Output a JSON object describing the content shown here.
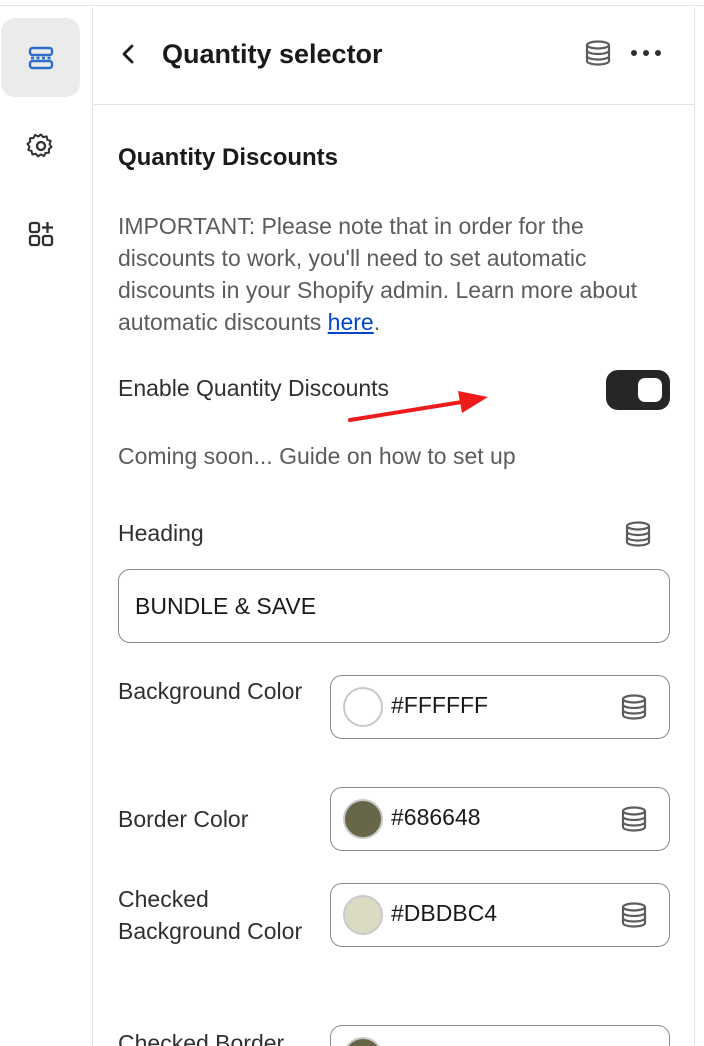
{
  "header": {
    "title": "Quantity selector"
  },
  "section": {
    "title": "Quantity Discounts",
    "note_text": "IMPORTANT: Please note that in order for the discounts to work, you'll need to set automatic discounts in your Shopify admin. Learn more about automatic discounts ",
    "note_link": "here",
    "note_end": "."
  },
  "toggle": {
    "label": "Enable Quantity Discounts",
    "enabled": true
  },
  "coming_soon": "Coming soon... Guide on how to set up",
  "heading_field": {
    "label": "Heading",
    "value": "BUNDLE & SAVE"
  },
  "colors": [
    {
      "label": "Background Color",
      "hex": "#FFFFFF",
      "swatch": "#FFFFFF"
    },
    {
      "label": "Border Color",
      "hex": "#686648",
      "swatch": "#686648"
    },
    {
      "label": "Checked Background Color",
      "hex": "#DBDBC4",
      "swatch": "#DBDBC4"
    },
    {
      "label": "Checked Border",
      "hex": "",
      "swatch": "#686648"
    }
  ],
  "icons": {
    "rail": [
      "sections-icon",
      "gear-icon",
      "add-app-icon"
    ],
    "header": [
      "chevron-left-icon",
      "database-icon",
      "more-icon"
    ]
  },
  "accent": "#2c6ecb"
}
